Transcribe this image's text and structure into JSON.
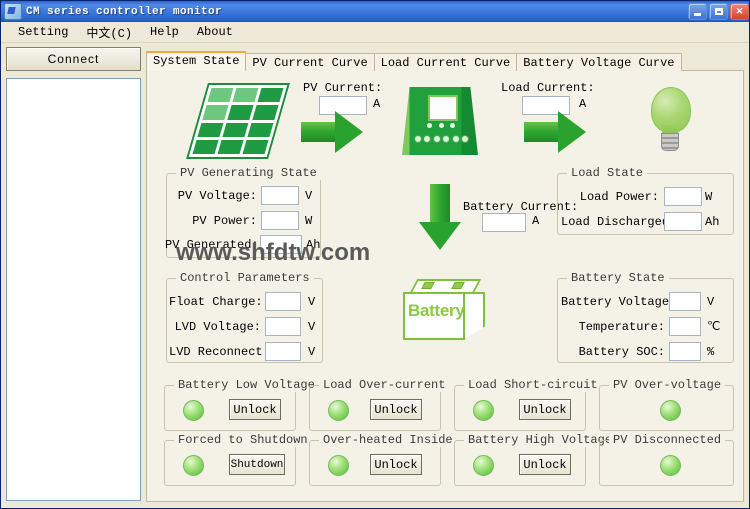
{
  "window": {
    "title": "CM series controller  monitor",
    "icon": "app-icon",
    "buttons": {
      "minimize": "minimize",
      "maximize": "maximize",
      "close": "close"
    }
  },
  "menu": {
    "items": [
      {
        "label": "Setting"
      },
      {
        "label": "中文(C)"
      },
      {
        "label": "Help"
      },
      {
        "label": "About"
      }
    ]
  },
  "sidebar": {
    "connect_label": "Connect",
    "log_items": []
  },
  "tabs": [
    {
      "label": "System State",
      "active": true
    },
    {
      "label": "PV Current Curve",
      "active": false
    },
    {
      "label": "Load Current Curve",
      "active": false
    },
    {
      "label": "Battery Voltage Curve",
      "active": false
    }
  ],
  "watermark": "www.shfdtw.com",
  "top_row": {
    "pv_current": {
      "label": "PV Current:",
      "value": "",
      "unit": "A"
    },
    "load_current": {
      "label": "Load Current:",
      "value": "",
      "unit": "A"
    },
    "icons": {
      "solar_panel": "solar-panel-icon",
      "controller": "charge-controller-icon",
      "bulb": "light-bulb-icon",
      "arrow_left": "arrow-right-icon",
      "arrow_right": "arrow-right-icon",
      "arrow_down": "arrow-down-icon"
    }
  },
  "battery_current": {
    "label": "Battery Current:",
    "value": "",
    "unit": "A"
  },
  "battery_icon_text": "Battery",
  "groups": {
    "pv_generating_state": {
      "title": "PV Generating State",
      "fields": [
        {
          "label": "PV Voltage:",
          "value": "",
          "unit": "V"
        },
        {
          "label": "PV Power:",
          "value": "",
          "unit": "W"
        },
        {
          "label": "PV Generated:",
          "value": "",
          "unit": "Ah"
        }
      ]
    },
    "load_state": {
      "title": "Load State",
      "fields": [
        {
          "label": "Load Power:",
          "value": "",
          "unit": "W"
        },
        {
          "label": "Load Discharged:",
          "value": "",
          "unit": "Ah"
        }
      ]
    },
    "control_parameters": {
      "title": "Control Parameters",
      "fields": [
        {
          "label": "Float Charge:",
          "value": "",
          "unit": "V"
        },
        {
          "label": "LVD Voltage:",
          "value": "",
          "unit": "V"
        },
        {
          "label": "LVD Reconnect:",
          "value": "",
          "unit": "V"
        }
      ]
    },
    "battery_state": {
      "title": "Battery State",
      "fields": [
        {
          "label": "Battery Voltage:",
          "value": "",
          "unit": "V"
        },
        {
          "label": "Temperature:",
          "value": "",
          "unit": "℃"
        },
        {
          "label": "Battery SOC:",
          "value": "",
          "unit": "%"
        }
      ]
    }
  },
  "status_panels": [
    {
      "title": "Battery Low Voltage",
      "led": "green",
      "button": "Unlock"
    },
    {
      "title": "Load Over-current",
      "led": "green",
      "button": "Unlock"
    },
    {
      "title": "Load Short-circuit",
      "led": "green",
      "button": "Unlock"
    },
    {
      "title": "PV Over-voltage",
      "led": "green",
      "button": null
    },
    {
      "title": "Forced to Shutdown",
      "led": "green",
      "button": "Shutdown"
    },
    {
      "title": "Over-heated Inside",
      "led": "green",
      "button": "Unlock"
    },
    {
      "title": "Battery High Voltage",
      "led": "green",
      "button": "Unlock"
    },
    {
      "title": "PV Disconnected",
      "led": "green",
      "button": null
    }
  ],
  "colors": {
    "titlebar": "#3c79de",
    "window_bg": "#ece9d8",
    "tab_page_bg": "#f4f2e7",
    "accent_tab": "#f2a93b",
    "green": "#2aa32e",
    "led_green": "#74cc4f"
  }
}
